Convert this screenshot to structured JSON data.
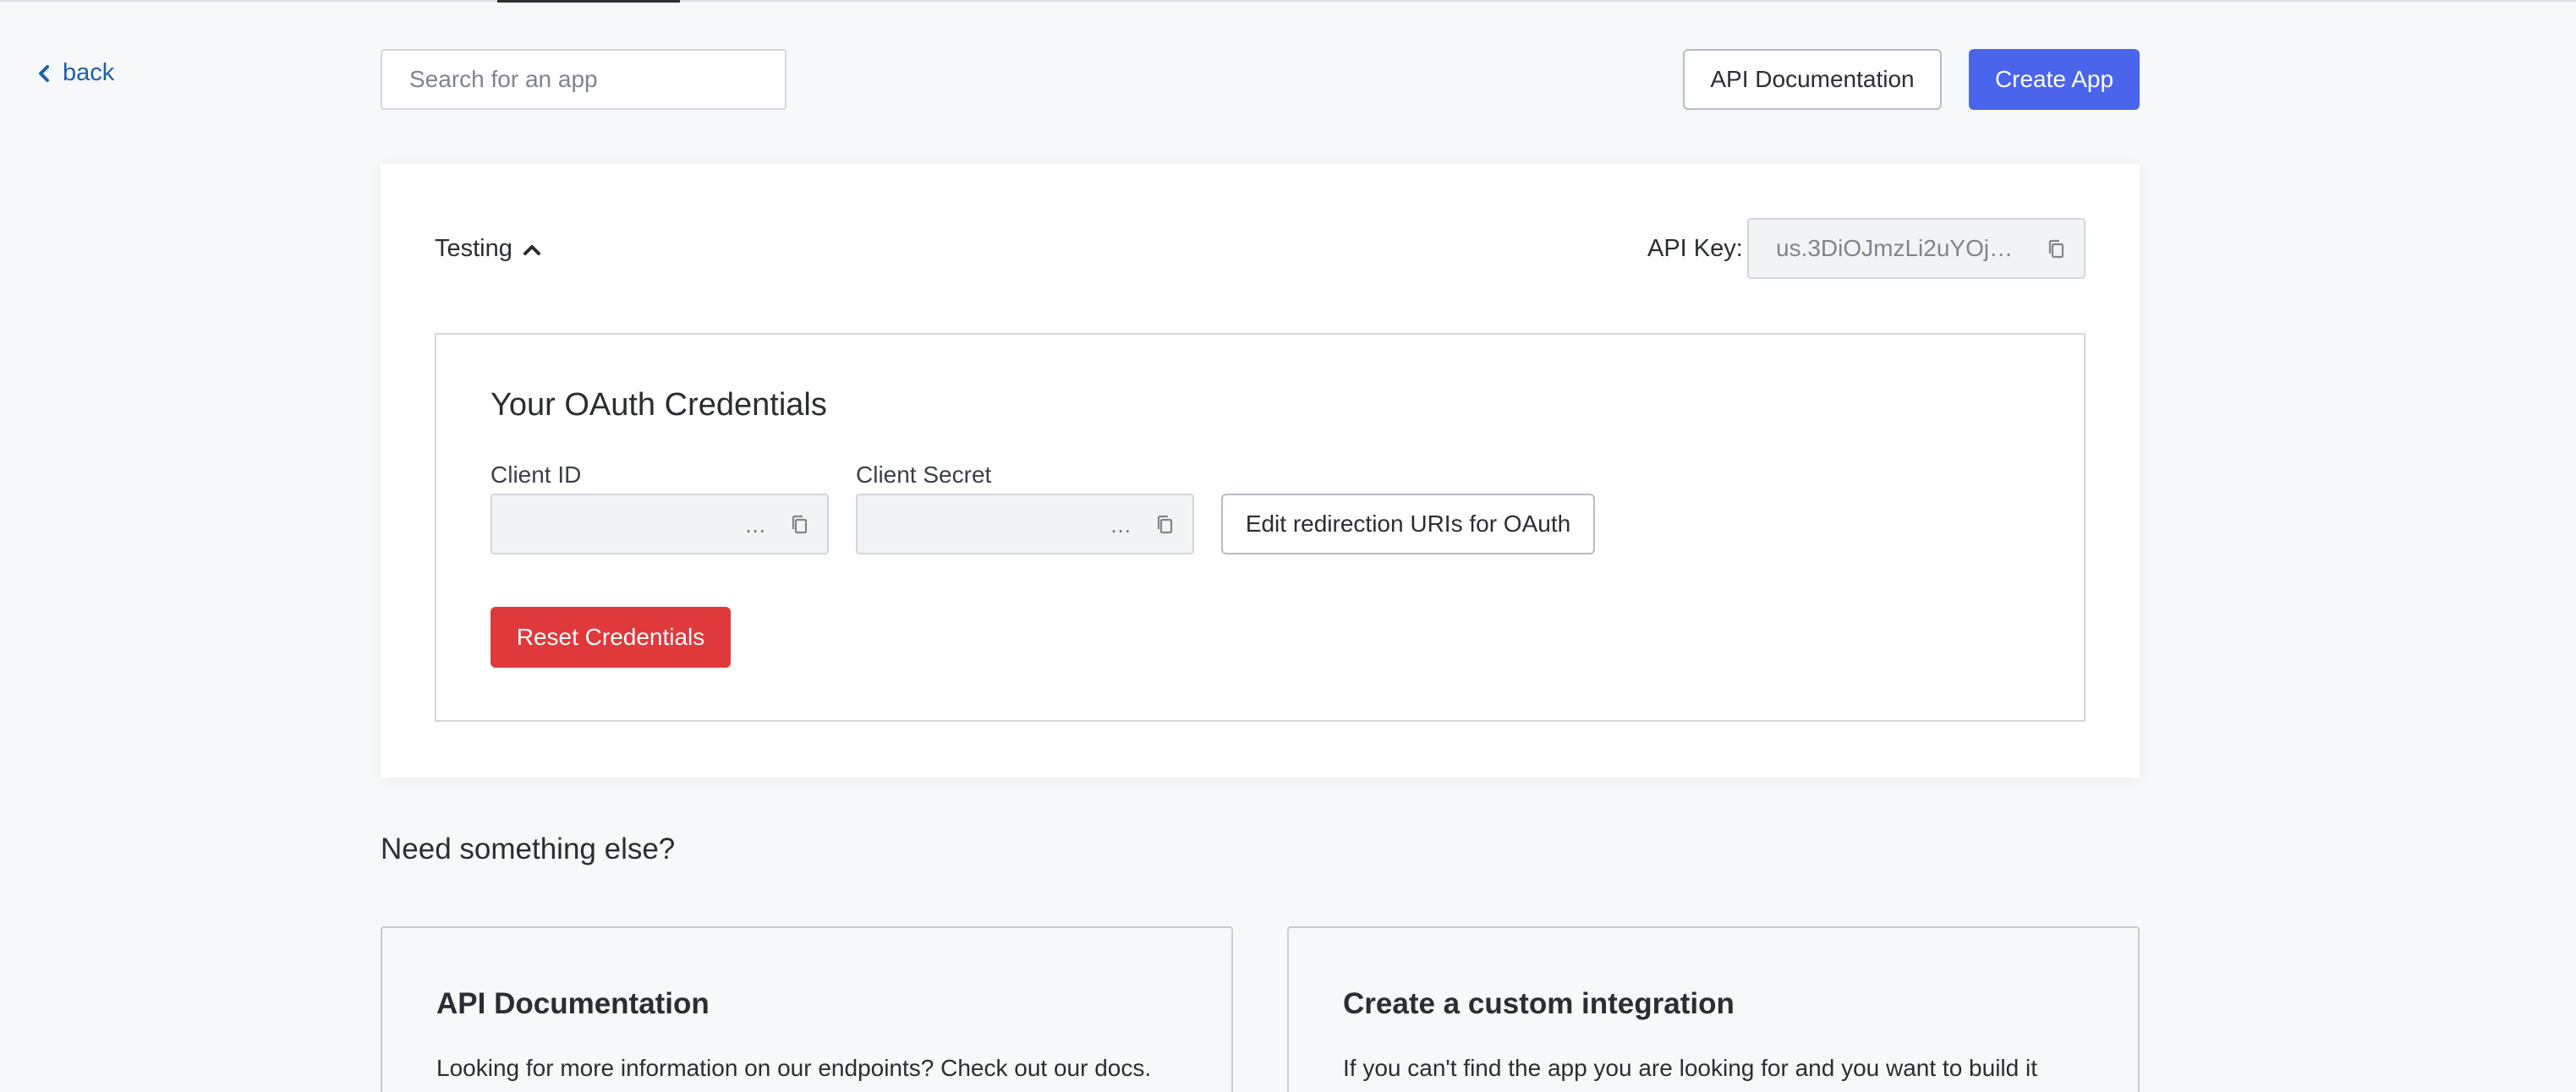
{
  "nav": {
    "back_label": "back"
  },
  "header": {
    "search_placeholder": "Search for an app",
    "api_docs_label": "API Documentation",
    "create_app_label": "Create App"
  },
  "app": {
    "environment": "Testing",
    "api_key_label": "API Key:",
    "api_key_value": "us.3DiOJmzLi2uYOjWj..."
  },
  "credentials": {
    "title": "Your OAuth Credentials",
    "client_id_label": "Client ID",
    "client_id_value": "...",
    "client_secret_label": "Client Secret",
    "client_secret_value": "...",
    "edit_uri_label": "Edit redirection URIs for OAuth",
    "reset_label": "Reset Credentials"
  },
  "more": {
    "title": "Need something else?",
    "cards": [
      {
        "title": "API Documentation",
        "text": "Looking for more information on our endpoints? Check out our docs."
      },
      {
        "title": "Create a custom integration",
        "text": "If you can't find the app you are looking for and you want to build it"
      }
    ]
  },
  "colors": {
    "primary": "#4a64ec",
    "danger": "#e0393b",
    "link": "#1f5fa8",
    "background": "#f7f8fa"
  },
  "icons": [
    "chevron-left-icon",
    "chevron-up-icon",
    "copy-icon"
  ]
}
